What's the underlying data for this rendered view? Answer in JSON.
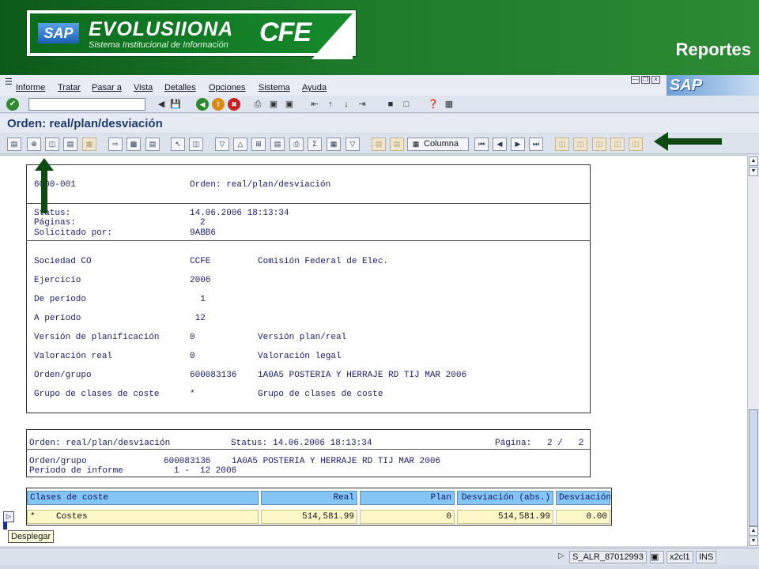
{
  "banner": {
    "logo_sap": "SAP",
    "logo_title": "EVOLUSIIONA",
    "logo_subtitle": "Sistema Institucional de Información",
    "logo_cfe": "CFE",
    "heading": "Reportes"
  },
  "menu": [
    "Informe",
    "Tratar",
    "Pasar a",
    "Vista",
    "Detalles",
    "Opciones",
    "Sistema",
    "Ayuda"
  ],
  "screen_title": "Orden: real/plan/desviación",
  "toolbar": {
    "columna_label": "Columna"
  },
  "report": {
    "header": {
      "id": "6000-001",
      "title": "Orden: real/plan/desviación",
      "status_label": "Status:",
      "status_value": "14.06.2006 18:13:34",
      "pages_label": "Páginas:",
      "pages_value": "2",
      "requested_label": "Solicitado por:",
      "requested_value": "9ABB6"
    },
    "params": [
      {
        "label": "Sociedad CO",
        "value": "CCFE",
        "desc": "Comisión Federal de Elec."
      },
      {
        "label": "Ejercicio",
        "value": "2006",
        "desc": ""
      },
      {
        "label": "De período",
        "value": "  1",
        "desc": ""
      },
      {
        "label": "A período",
        "value": " 12",
        "desc": ""
      },
      {
        "label": "Versión de planificación",
        "value": "0",
        "desc": "Versión plan/real"
      },
      {
        "label": "Valoración real",
        "value": "0",
        "desc": "Valoración legal"
      },
      {
        "label": "Orden/grupo",
        "value": "600083136",
        "desc": "1A0A5 POSTERIA Y HERRAJE RD TIJ MAR 2006"
      },
      {
        "label": "Grupo de clases de coste",
        "value": "*",
        "desc": "Grupo de clases de coste"
      }
    ],
    "page2": {
      "title": "Orden: real/plan/desviación",
      "status_label": "Status:",
      "status_value": "14.06.2006 18:13:34",
      "page_label": "Página:",
      "page_value": "2 /   2",
      "order_label": "Orden/grupo",
      "order_value": "600083136",
      "order_desc": "1A0A5 POSTERIA Y HERRAJE RD TIJ MAR 2006",
      "period_label": "Período de informe",
      "period_value": "1 -  12 2006"
    },
    "table": {
      "headers": [
        "Clases de coste",
        "Real",
        "Plan",
        "Desviación (abs.)",
        "Desviación"
      ],
      "rows": [
        {
          "clase": "*    Costes",
          "real": "514,581.99",
          "plan": "0",
          "desv_abs": "514,581.99",
          "desv": "0.00"
        }
      ]
    }
  },
  "tooltip": "Desplegar",
  "statusbar": {
    "transaction": "S_ALR_87012993",
    "server": "x2cl1",
    "mode": "INS"
  },
  "colors": {
    "banner_green": "#1d7a2a",
    "table_header": "#84c5f4",
    "table_row": "#fbf7c6",
    "title_blue": "#1d3c6e"
  }
}
